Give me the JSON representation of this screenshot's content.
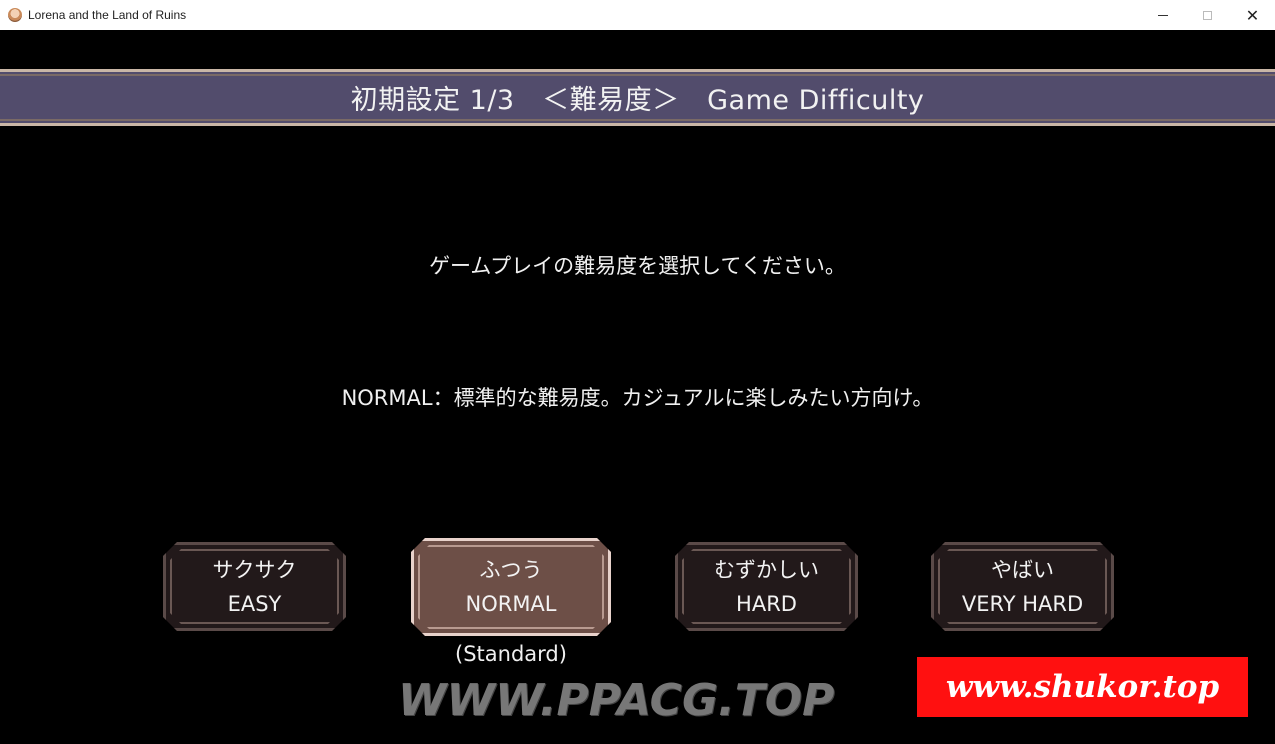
{
  "window": {
    "title": "Lorena and the Land of Ruins",
    "controls": {
      "minimize": "—",
      "maximize": "☐",
      "close": "✕"
    }
  },
  "banner": {
    "text": "初期設定 1/3　＜難易度＞　Game Difficulty"
  },
  "prompt": "ゲームプレイの難易度を選択してください。",
  "description": "NORMAL：標準的な難易度。カジュアルに楽しみたい方向け。",
  "difficulties": [
    {
      "jp": "サクサク",
      "en": "EASY",
      "selected": false
    },
    {
      "jp": "ふつう",
      "en": "NORMAL",
      "selected": true
    },
    {
      "jp": "むずかしい",
      "en": "HARD",
      "selected": false
    },
    {
      "jp": "やばい",
      "en": "VERY HARD",
      "selected": false
    }
  ],
  "normal_sublabel": "(Standard)",
  "watermarks": {
    "left": "WWW.PPACG.TOP",
    "right": "www.shukor.top"
  },
  "colors": {
    "banner_bg": "#524c6c",
    "banner_border": "#c9b6a6",
    "button_bg": "#22191a",
    "button_selected_bg": "#6d4f47",
    "watermark_red": "#ff1010"
  }
}
